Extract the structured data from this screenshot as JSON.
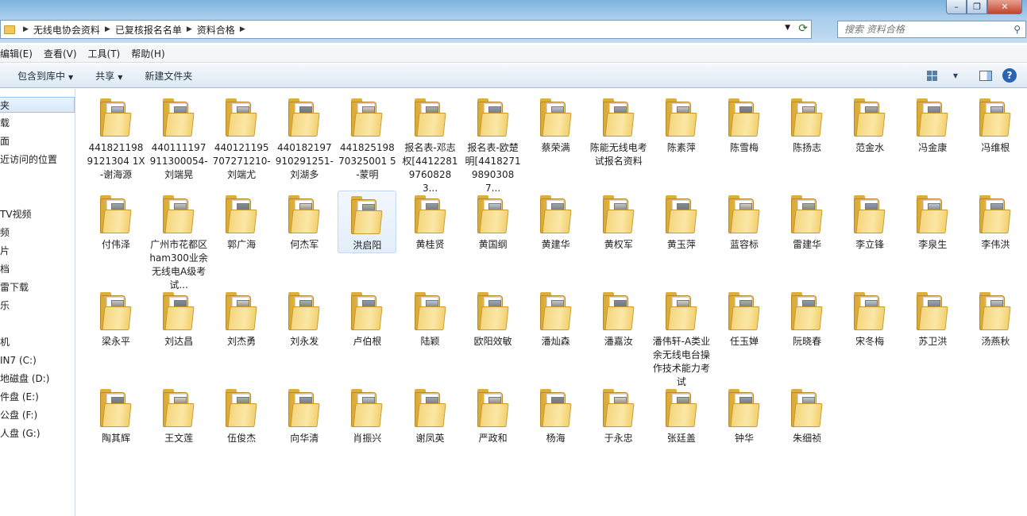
{
  "address": {
    "crumbs": [
      "无线电协会资料",
      "已复核报名名单",
      "资料合格"
    ]
  },
  "search": {
    "placeholder": "搜索 资料合格"
  },
  "menu": [
    "编辑(E)",
    "查看(V)",
    "工具(T)",
    "帮助(H)"
  ],
  "commands": {
    "include_library": "包含到库中",
    "share": "共享",
    "new_folder": "新建文件夹"
  },
  "nav": [
    "夹",
    "载",
    "面",
    "近访问的位置",
    "TV视频",
    "频",
    "片",
    "档",
    "雷下载",
    "乐",
    "机",
    "IN7 (C:)",
    "地磁盘 (D:)",
    "件盘 (E:)",
    "公盘 (F:)",
    "人盘 (G:)"
  ],
  "folders": [
    "4418211989121304 1X-谢海源",
    "440111197911300054-刘端晃",
    "440121195707271210-刘端尤",
    "440182197910291251-刘湖多",
    "44182519870325001 5-蒙明",
    "报名表-邓志权[44122819760828 3...",
    "报名表-欧楚明[44182719890308 7...",
    "蔡荣满",
    "陈能无线电考试报名资料",
    "陈素萍",
    "陈雪梅",
    "陈扬志",
    "范金水",
    "冯金康",
    "冯维根",
    "付伟泽",
    "广州市花都区 ham300业余无线电A级考试...",
    "郭广海",
    "何杰军",
    "洪启阳",
    "黄桂贤",
    "黄国纲",
    "黄建华",
    "黄权军",
    "黄玉萍",
    "蓝容标",
    "雷建华",
    "李立锋",
    "李泉生",
    "李伟洪",
    "梁永平",
    "刘达昌",
    "刘杰勇",
    "刘永发",
    "卢伯根",
    "陆颖",
    "欧阳效敏",
    "潘灿森",
    "潘嘉汝",
    "潘伟轩-A类业余无线电台操作技术能力考试",
    "任玉婵",
    "阮晓春",
    "宋冬梅",
    "苏卫洪",
    "汤燕秋",
    "陶其辉",
    "王文莲",
    "伍俊杰",
    "向华清",
    "肖振兴",
    "谢凤英",
    "严政和",
    "杨海",
    "于永忠",
    "张廷盖",
    "钟华",
    "朱细祯"
  ],
  "selected_folder": "洪启阳"
}
